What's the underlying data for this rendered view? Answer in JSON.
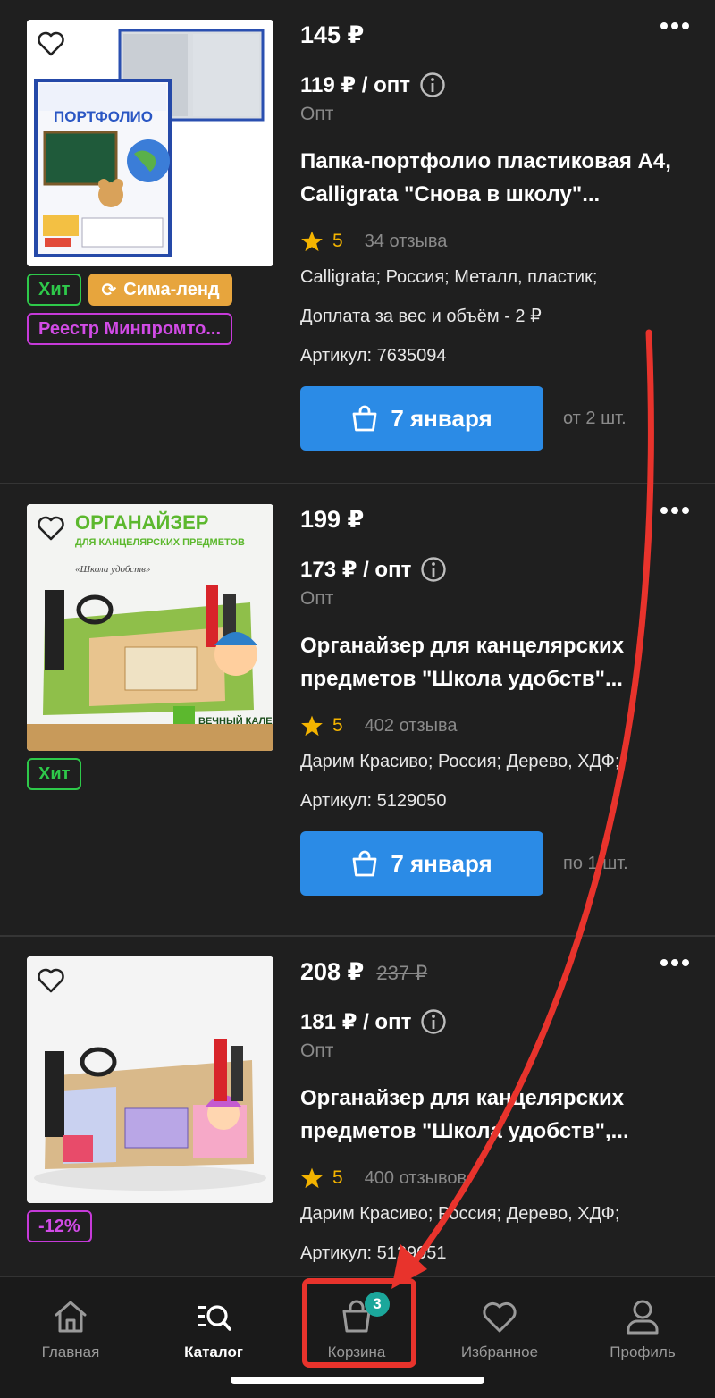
{
  "products": [
    {
      "price": "145 ₽",
      "old_price": "",
      "opt_price": "119 ₽ / опт",
      "opt_label": "Опт",
      "title": "Папка-портфолио пластиковая А4, Calligrata \"Снова в школу\"...",
      "rating": "5",
      "reviews": "34 отзыва",
      "meta": [
        "Calligrata; Россия; Металл, пластик;",
        "Доплата за вес и объём - 2 ₽",
        "Артикул: 7635094"
      ],
      "delivery": "7 января",
      "min_qty": "от 2 шт.",
      "badges": [
        "Хит",
        "Сима-ленд",
        "Реестр Минпромто..."
      ]
    },
    {
      "price": "199 ₽",
      "old_price": "",
      "opt_price": "173 ₽ / опт",
      "opt_label": "Опт",
      "title": "Органайзер для канцелярских предметов \"Школа удобств\"...",
      "rating": "5",
      "reviews": "402 отзыва",
      "meta": [
        "Дарим Красиво; Россия; Дерево, ХДФ;",
        "Артикул: 5129050"
      ],
      "delivery": "7 января",
      "min_qty": "по 1 шт.",
      "badges": [
        "Хит"
      ],
      "image_text": [
        "ОРГАНАЙЗЕР",
        "ДЛЯ КАНЦЕЛЯРСКИХ ПРЕДМЕТОВ",
        "«Школа удобств»",
        "ВЕЧНЫЙ КАЛЕНДАРЬ"
      ]
    },
    {
      "price": "208 ₽",
      "old_price": "237 ₽",
      "opt_price": "181 ₽ / опт",
      "opt_label": "Опт",
      "title": "Органайзер для канцелярских предметов \"Школа удобств\",...",
      "rating": "5",
      "reviews": "400 отзывов",
      "meta": [
        "Дарим Красиво; Россия; Дерево, ХДФ;",
        "Артикул: 5129051"
      ],
      "badges": [
        "-12%"
      ]
    }
  ],
  "product1_image_text": "ПОРТФОЛИО",
  "nav": {
    "home": "Главная",
    "catalog": "Каталог",
    "cart": "Корзина",
    "cart_count": "3",
    "favorites": "Избранное",
    "profile": "Профиль"
  },
  "colors": {
    "background": "#1f1f1f",
    "buy_button": "#2b8be6",
    "hit_badge": "#2ec94a",
    "sima_badge": "#e7a53d",
    "purple_badge": "#c63ad9",
    "star": "#f4b400",
    "cart_badge": "#1ba79b",
    "annotation": "#e8332c"
  },
  "icons": [
    "heart-icon",
    "more-dots-icon",
    "info-icon",
    "star-icon",
    "shopping-bag-icon",
    "home-icon",
    "catalog-search-icon",
    "cart-icon",
    "favorites-heart-icon",
    "profile-icon"
  ]
}
